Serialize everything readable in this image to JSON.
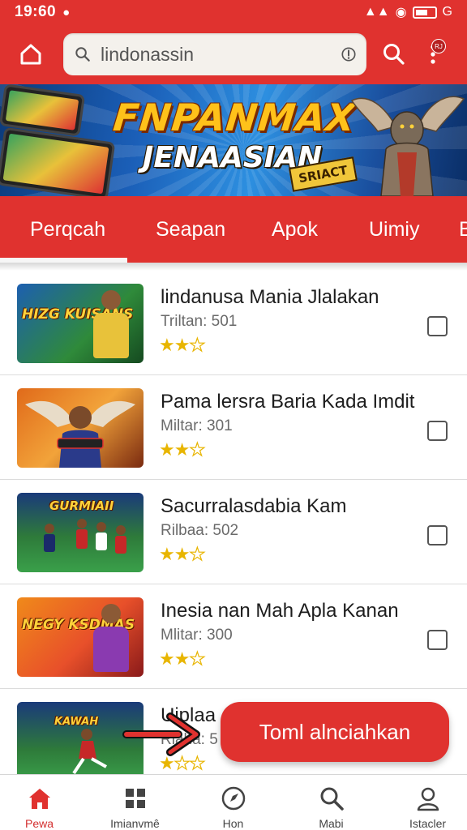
{
  "status_bar": {
    "time": "19:60",
    "carrier_tag": "G"
  },
  "search": {
    "value": "lindonassin"
  },
  "menu_badge": "RJ",
  "banner": {
    "title": "FNPANMAX",
    "subtitle": "JENAASIAN",
    "tag": "SRIACT"
  },
  "tabs": [
    {
      "label": "Perqcah",
      "active": true
    },
    {
      "label": "Seapan"
    },
    {
      "label": "Apok"
    },
    {
      "label": "Uimiy"
    },
    {
      "label": "B"
    }
  ],
  "items": [
    {
      "title": "lindanusa Mania Jlalakan",
      "subtitle": "Triltan: 501",
      "rating": 2,
      "thumb_caption": "HIZG KUISANS"
    },
    {
      "title": "Pama lersra Baria Kada Imdit",
      "subtitle": "Miltar: 301",
      "rating": 2,
      "thumb_caption": ""
    },
    {
      "title": "Sacurralasdabia Kam",
      "subtitle": "Rilbaa: 502",
      "rating": 2,
      "thumb_caption": "GURMIAII"
    },
    {
      "title": "Inesia nan Mah Apla Kanan",
      "subtitle": "Mlitar: 300",
      "rating": 2,
      "thumb_caption": "NEGY KSDMAS"
    },
    {
      "title": "Uiplaa",
      "subtitle": "Riaha: 5",
      "rating": 1,
      "thumb_caption": "KAWAH"
    }
  ],
  "fab_label": "Toml alnciahkan",
  "bottom_nav": [
    {
      "label": "Pewa",
      "icon": "home-icon",
      "active": true
    },
    {
      "label": "Imianvmê",
      "icon": "grid-icon"
    },
    {
      "label": "Hon",
      "icon": "compass-icon"
    },
    {
      "label": "Mabi",
      "icon": "search-icon"
    },
    {
      "label": "Istacler",
      "icon": "profile-icon"
    }
  ],
  "colors": {
    "primary": "#e0322f",
    "star": "#e8b500"
  }
}
